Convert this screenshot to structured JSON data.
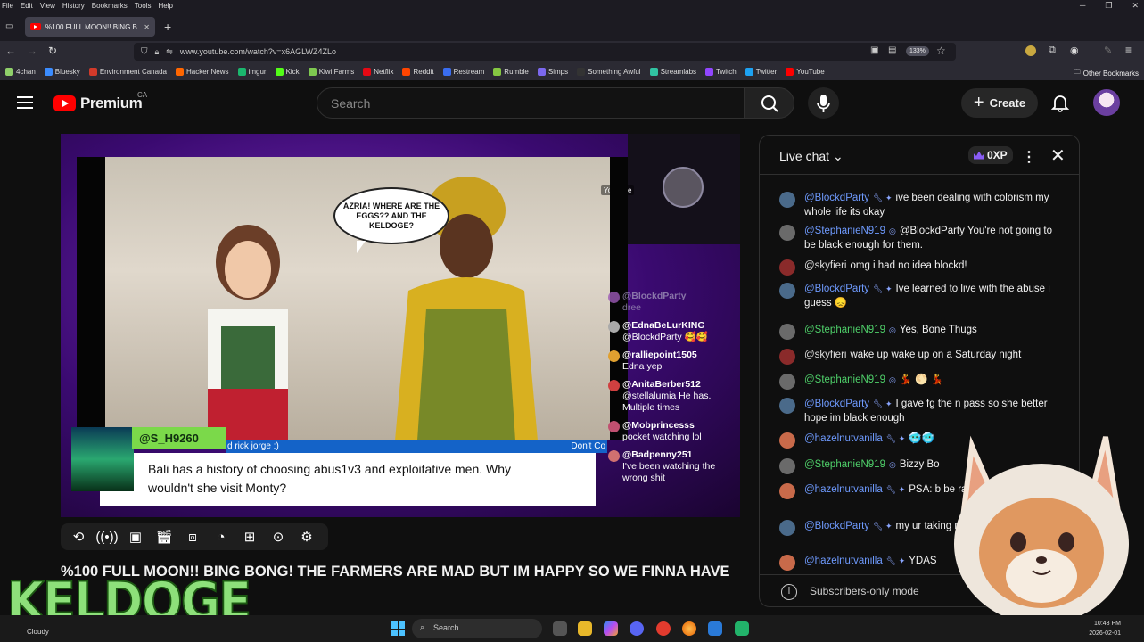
{
  "browser": {
    "menu": [
      "File",
      "Edit",
      "View",
      "History",
      "Bookmarks",
      "Tools",
      "Help"
    ],
    "tab_title": "%100 FULL MOON!! BING B",
    "url": "www.youtube.com/watch?v=x6AGLWZ4ZLo",
    "zoom": "133%",
    "bookmarks": [
      {
        "label": "4chan",
        "color": "#8fcf6a"
      },
      {
        "label": "Bluesky",
        "color": "#3b8cff"
      },
      {
        "label": "Environment Canada",
        "color": "#d23a2a"
      },
      {
        "label": "Hacker News",
        "color": "#ff6600"
      },
      {
        "label": "imgur",
        "color": "#1bb76e"
      },
      {
        "label": "Kick",
        "color": "#53fc18"
      },
      {
        "label": "Kiwi Farms",
        "color": "#7ec850"
      },
      {
        "label": "Netflix",
        "color": "#e50914"
      },
      {
        "label": "Reddit",
        "color": "#ff4500"
      },
      {
        "label": "Restream",
        "color": "#3a6df0"
      },
      {
        "label": "Rumble",
        "color": "#85c742"
      },
      {
        "label": "Simps",
        "color": "#7b68ee"
      },
      {
        "label": "Something Awful",
        "color": "#333333"
      },
      {
        "label": "Streamlabs",
        "color": "#31c3a2"
      },
      {
        "label": "Twitch",
        "color": "#9146ff"
      },
      {
        "label": "Twitter",
        "color": "#1da1f2"
      },
      {
        "label": "YouTube",
        "color": "#ff0000"
      }
    ],
    "other_bookmarks": "Other Bookmarks"
  },
  "youtube": {
    "logo_text": "Premium",
    "region": "CA",
    "search_placeholder": "Search",
    "create_label": "Create"
  },
  "player": {
    "bubble_text": "AZRIA! WHERE ARE THE EGGS?? AND THE KELDOGE?",
    "watermark": "YouTube",
    "overlay_chat": [
      {
        "name": "@BlockdParty",
        "text": "dree",
        "faded": true,
        "color": "#9b59b6"
      },
      {
        "name": "@EdnaBeLurKING",
        "text": "@BlockdParty 🥰🥰",
        "faded": false,
        "color": "#aaaaaa"
      },
      {
        "name": "@ralliepoint1505",
        "text": "Edna yep",
        "faded": false,
        "color": "#e0a030"
      },
      {
        "name": "@AnitaBerber512",
        "text": "@stellalumia He has. Multiple times",
        "faded": false,
        "color": "#d04040"
      },
      {
        "name": "@Mobprincesss",
        "text": "pocket watching lol",
        "faded": false,
        "color": "#c05070"
      },
      {
        "name": "@Badpenny251",
        "text": "I've been watching the wrong shit",
        "faded": false,
        "color": "#d07070"
      }
    ],
    "highlight": {
      "name": "@S_H9260",
      "bar_text": "d rick jorge :)",
      "bar_right": "Don't Co",
      "message": "Bali has a history of choosing abus1v3 and exploitative men. Why wouldn't she visit Monty?"
    }
  },
  "video_title": "%100 FULL MOON!! BING BONG! THE FARMERS ARE MAD BUT IM HAPPY SO WE FINNA HAVE",
  "chat": {
    "title": "Live chat",
    "xp": "0XP",
    "footer": "Subscribers-only mode",
    "messages": [
      {
        "name": "@BlockdParty",
        "name_color": "blue",
        "mod": true,
        "text": "ive been dealing with colorism my whole life its okay",
        "ava": "#4a6a8a"
      },
      {
        "name": "@StephanieN919",
        "name_color": "blue",
        "mod": false,
        "member": true,
        "text": "@BlockdParty You're not going to be black enough for them.",
        "ava": "#6a6a6a"
      },
      {
        "name": "@skyfieri",
        "name_color": "white",
        "mod": false,
        "text": "omg i had no idea blockd!",
        "ava": "#8a2a2a"
      },
      {
        "name": "@BlockdParty",
        "name_color": "blue",
        "mod": true,
        "text": "Ive learned to live with the abuse i guess 😞",
        "ava": "#4a6a8a"
      },
      {
        "name": "@StephanieN919",
        "name_color": "green",
        "mod": false,
        "member": true,
        "text": "Yes, Bone Thugs",
        "ava": "#6a6a6a"
      },
      {
        "name": "@skyfieri",
        "name_color": "white",
        "mod": false,
        "text": "wake up wake up on a Saturday night",
        "ava": "#8a2a2a"
      },
      {
        "name": "@StephanieN919",
        "name_color": "green",
        "mod": false,
        "member": true,
        "text": "💃 🌕 💃",
        "ava": "#6a6a6a"
      },
      {
        "name": "@BlockdParty",
        "name_color": "blue",
        "mod": true,
        "text": "I gave fg the n pass so she better hope im black enough",
        "ava": "#4a6a8a"
      },
      {
        "name": "@hazelnutvanilla",
        "name_color": "blue",
        "mod": true,
        "text": "🥶🥶",
        "ava": "#c86a4a"
      },
      {
        "name": "@StephanieN919",
        "name_color": "green",
        "mod": false,
        "member": true,
        "text": "Bizzy Bo",
        "ava": "#6a6a6a"
      },
      {
        "name": "@hazelnutvanilla",
        "name_color": "blue",
        "mod": true,
        "text": "PSA: b be racist 😒😤",
        "ava": "#c86a4a"
      },
      {
        "name": "@BlockdParty",
        "name_color": "blue",
        "mod": true,
        "text": "my ur taking me to the store to get",
        "ava": "#4a6a8a"
      },
      {
        "name": "@hazelnutvanilla",
        "name_color": "blue",
        "mod": true,
        "text": "YDAS",
        "ava": "#c86a4a"
      }
    ]
  },
  "overlay_label": "KELDOGE",
  "taskbar": {
    "weather": "Cloudy",
    "search": "Search",
    "time": "10:43 PM",
    "date": "2026-02-01"
  }
}
